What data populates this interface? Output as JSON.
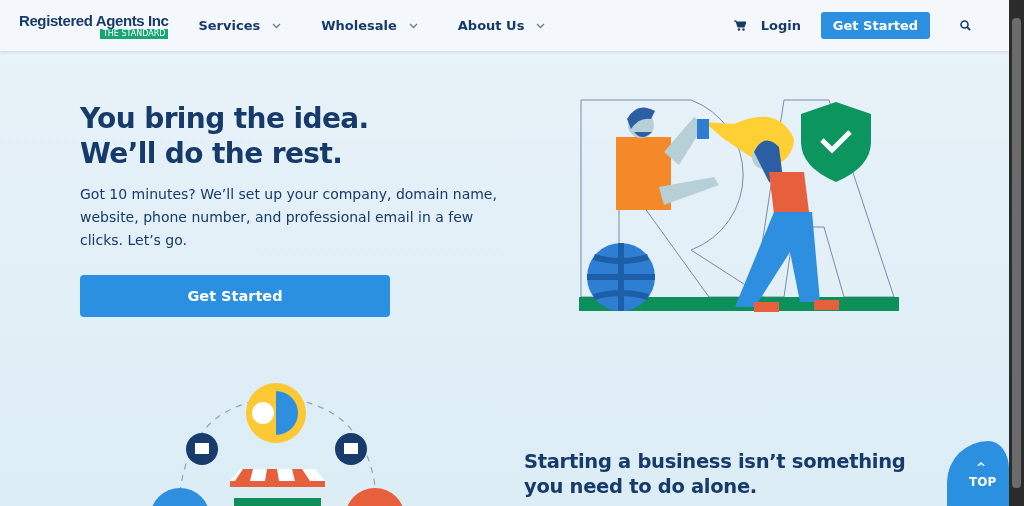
{
  "header": {
    "logo": "Registered Agents Inc",
    "logo_tag": "THE STANDARD",
    "nav": [
      {
        "label": "Services"
      },
      {
        "label": "Wholesale"
      },
      {
        "label": "About Us"
      }
    ],
    "login": "Login",
    "cta": "Get Started"
  },
  "hero": {
    "headline_lines": [
      "You bring the idea.",
      "We’ll do the rest."
    ],
    "text": "Got 10 minutes? We’ll set up your company, domain name, website, phone number, and professional email in a few clicks. Let’s go.",
    "button": "Get Started"
  },
  "section": {
    "heading": "Starting a business isn’t something you need to do alone."
  },
  "top_button": {
    "arrow": "^",
    "label": "TOP"
  }
}
